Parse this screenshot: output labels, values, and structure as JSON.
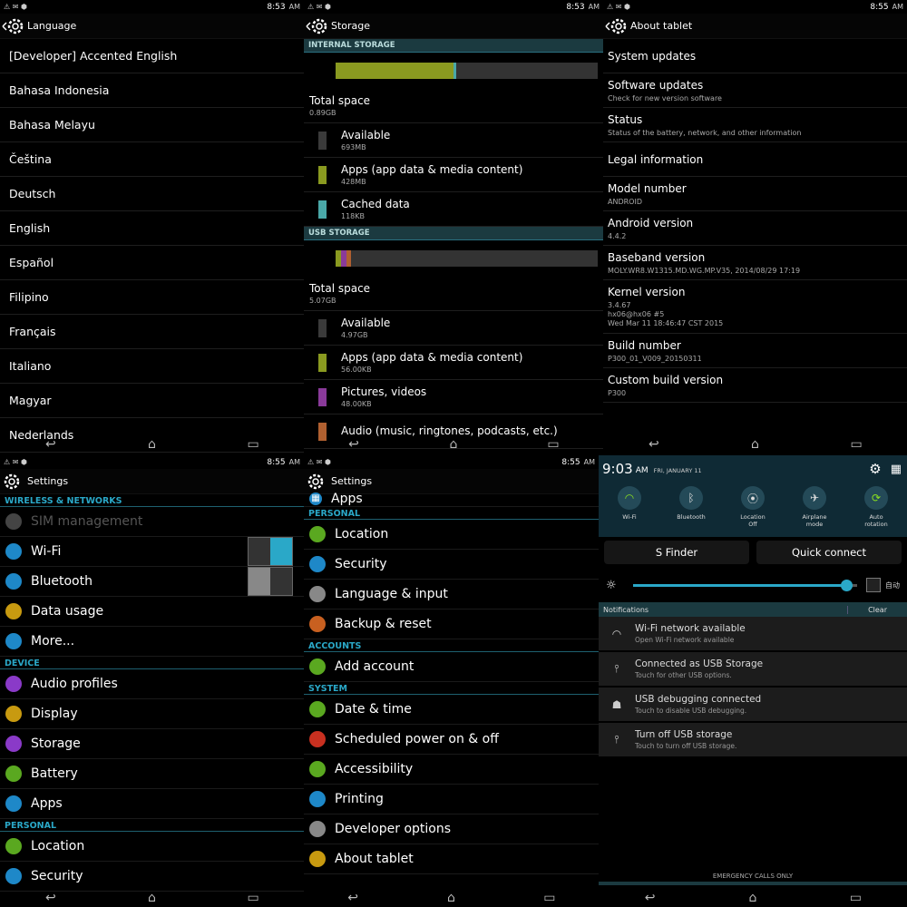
{
  "status": {
    "time_1": "8:53",
    "ampm": "AM",
    "time_3": "8:55"
  },
  "language": {
    "title": "Language",
    "items": [
      "[Developer] Accented English",
      "Bahasa Indonesia",
      "Bahasa Melayu",
      "Čeština",
      "Deutsch",
      "English",
      "Español",
      "Filipino",
      "Français",
      "Italiano",
      "Magyar",
      "Nederlands"
    ]
  },
  "storage": {
    "title": "Storage",
    "internal_header": "INTERNAL STORAGE",
    "internal": [
      {
        "label": "Total space",
        "value": "0.89GB"
      },
      {
        "label": "Available",
        "value": "693MB",
        "color": "#3a3a3a"
      },
      {
        "label": "Apps (app data & media content)",
        "value": "428MB",
        "color": "#8a9a20"
      },
      {
        "label": "Cached data",
        "value": "118KB",
        "color": "#4aa8a8"
      }
    ],
    "usb_header": "USB STORAGE",
    "usb": [
      {
        "label": "Total space",
        "value": "5.07GB"
      },
      {
        "label": "Available",
        "value": "4.97GB",
        "color": "#3a3a3a"
      },
      {
        "label": "Apps (app data & media content)",
        "value": "56.00KB",
        "color": "#8a9a20"
      },
      {
        "label": "Pictures, videos",
        "value": "48.00KB",
        "color": "#8a3a9a"
      },
      {
        "label": "Audio (music, ringtones, podcasts, etc.)",
        "value": "",
        "color": "#b06030"
      }
    ]
  },
  "about": {
    "title": "About tablet",
    "items": [
      {
        "t": "System updates",
        "s": ""
      },
      {
        "t": "Software updates",
        "s": "Check for new version software"
      },
      {
        "t": "Status",
        "s": "Status of the battery, network, and other information"
      },
      {
        "t": "Legal information",
        "s": ""
      },
      {
        "t": "Model number",
        "s": "ANDROID"
      },
      {
        "t": "Android version",
        "s": "4.4.2"
      },
      {
        "t": "Baseband version",
        "s": "MOLY.WR8.W1315.MD.WG.MP.V35, 2014/08/29 17:19"
      },
      {
        "t": "Kernel version",
        "s": "3.4.67\nhx06@hx06 #5\nWed Mar 11 18:46:47 CST 2015"
      },
      {
        "t": "Build number",
        "s": "P300_01_V009_20150311"
      },
      {
        "t": "Custom build version",
        "s": "P300"
      }
    ]
  },
  "settings1": {
    "title": "Settings",
    "time": "8:55",
    "sec_wireless": "WIRELESS & NETWORKS",
    "wireless": [
      {
        "label": "SIM management",
        "icon": "sim-icon",
        "color": "#444",
        "dim": true
      },
      {
        "label": "Wi-Fi",
        "icon": "wifi-icon",
        "color": "#1e88c8"
      },
      {
        "label": "Bluetooth",
        "icon": "bluetooth-icon",
        "color": "#1e88c8"
      },
      {
        "label": "Data usage",
        "icon": "data-usage-icon",
        "color": "#c89a10"
      },
      {
        "label": "More...",
        "icon": "more-icon",
        "color": "#1e88c8"
      }
    ],
    "sec_device": "DEVICE",
    "device": [
      {
        "label": "Audio profiles",
        "icon": "audio-icon",
        "color": "#8a3ac8"
      },
      {
        "label": "Display",
        "icon": "display-icon",
        "color": "#c89a10"
      },
      {
        "label": "Storage",
        "icon": "storage-icon",
        "color": "#8a3ac8"
      },
      {
        "label": "Battery",
        "icon": "battery-icon",
        "color": "#5aa820"
      },
      {
        "label": "Apps",
        "icon": "apps-icon",
        "color": "#1e88c8"
      }
    ],
    "sec_personal": "PERSONAL",
    "personal": [
      {
        "label": "Location",
        "icon": "location-icon",
        "color": "#5aa820"
      },
      {
        "label": "Security",
        "icon": "security-icon",
        "color": "#1e88c8"
      }
    ]
  },
  "settings2": {
    "title": "Settings",
    "time": "8:55",
    "top_item": "Apps",
    "sec_personal": "PERSONAL",
    "personal": [
      {
        "label": "Location",
        "icon": "location-icon",
        "color": "#5aa820"
      },
      {
        "label": "Security",
        "icon": "security-icon",
        "color": "#1e88c8"
      },
      {
        "label": "Language & input",
        "icon": "language-icon",
        "color": "#888"
      },
      {
        "label": "Backup & reset",
        "icon": "backup-icon",
        "color": "#c86020"
      }
    ],
    "sec_accounts": "ACCOUNTS",
    "accounts": [
      {
        "label": "Add account",
        "icon": "add-account-icon",
        "color": "#5aa820"
      }
    ],
    "sec_system": "SYSTEM",
    "system": [
      {
        "label": "Date & time",
        "icon": "clock-icon",
        "color": "#5aa820"
      },
      {
        "label": "Scheduled power on & off",
        "icon": "power-icon",
        "color": "#c83020"
      },
      {
        "label": "Accessibility",
        "icon": "accessibility-icon",
        "color": "#5aa820"
      },
      {
        "label": "Printing",
        "icon": "printer-icon",
        "color": "#1e88c8"
      },
      {
        "label": "Developer options",
        "icon": "developer-icon",
        "color": "#888"
      },
      {
        "label": "About tablet",
        "icon": "info-icon",
        "color": "#c89a10"
      }
    ]
  },
  "notif": {
    "time": "9:03",
    "ampm": "AM",
    "date": "FRI, JANUARY 11",
    "toggles": [
      {
        "label": "Wi-Fi",
        "icon": "wifi-icon",
        "on": true
      },
      {
        "label": "Bluetooth",
        "icon": "bluetooth-icon",
        "on": false
      },
      {
        "label": "Location\nOff",
        "icon": "location-icon",
        "on": false
      },
      {
        "label": "Airplane\nmode",
        "icon": "airplane-icon",
        "on": false
      },
      {
        "label": "Auto\nrotation",
        "icon": "rotation-icon",
        "on": true
      }
    ],
    "sfinder": "S Finder",
    "quick_connect": "Quick connect",
    "brightness_auto": "自动",
    "brightness_level": 0.95,
    "notifications_label": "Notifications",
    "clear": "Clear",
    "items": [
      {
        "t": "Wi-Fi network available",
        "s": "Open Wi-Fi network available",
        "icon": "wifi-icon"
      },
      {
        "t": "Connected as USB Storage",
        "s": "Touch for other USB options.",
        "icon": "usb-icon"
      },
      {
        "t": "USB debugging connected",
        "s": "Touch to disable USB debugging.",
        "icon": "android-icon"
      },
      {
        "t": "Turn off USB storage",
        "s": "Touch to turn off USB storage.",
        "icon": "usb-icon"
      }
    ],
    "emergency": "EMERGENCY CALLS ONLY"
  }
}
